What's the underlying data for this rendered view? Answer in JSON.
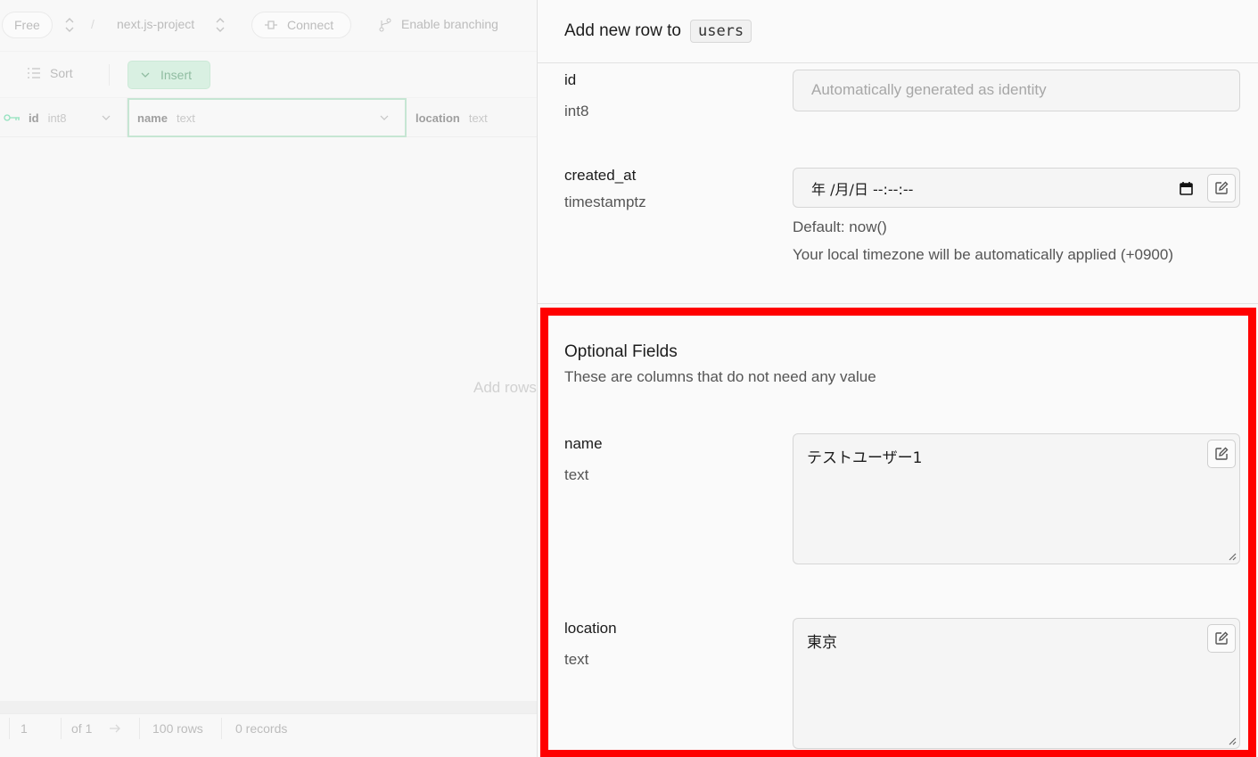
{
  "topbar": {
    "plan_badge": "Free",
    "project_name": "next.js-project",
    "connect_label": "Connect",
    "branching_label": "Enable branching"
  },
  "toolbar": {
    "sort_label": "Sort",
    "insert_label": "Insert"
  },
  "grid": {
    "columns": [
      {
        "name": "id",
        "type": "int8"
      },
      {
        "name": "name",
        "type": "text"
      },
      {
        "name": "location",
        "type": "text"
      }
    ],
    "empty_message": "Add rows"
  },
  "footer": {
    "page": "1",
    "of_pages": "of 1",
    "rows_per_page": "100 rows",
    "records": "0 records"
  },
  "panel": {
    "title": "Add new row to",
    "table_name": "users",
    "fields": {
      "id": {
        "label": "id",
        "type": "int8",
        "placeholder": "Automatically generated as identity"
      },
      "created_at": {
        "label": "created_at",
        "type": "timestamptz",
        "value": "年 /月/日 --:--:--",
        "default_note": "Default: now()",
        "timezone_note": "Your local timezone will be automatically applied (+0900)"
      }
    },
    "optional": {
      "title": "Optional Fields",
      "description": "These are columns that do not need any value",
      "name": {
        "label": "name",
        "type": "text",
        "value": "テストユーザー1"
      },
      "location": {
        "label": "location",
        "type": "text",
        "value": "東京"
      }
    }
  },
  "colors": {
    "highlight_border": "#ff0000",
    "brand_green": "#3ecf8e"
  }
}
